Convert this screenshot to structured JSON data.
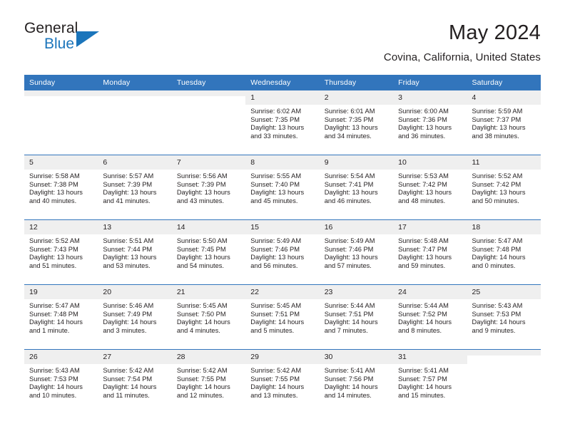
{
  "logo": {
    "word_one": "General",
    "word_two": "Blue",
    "triangle_color": "#1b75bb",
    "text_color": "#231f20"
  },
  "header": {
    "title": "May 2024",
    "subtitle": "Covina, California, United States"
  },
  "colors": {
    "header_blue": "#3275bc",
    "daynum_band": "#efefef",
    "text": "#231f20"
  },
  "calendar": {
    "weekday_headers": [
      "Sunday",
      "Monday",
      "Tuesday",
      "Wednesday",
      "Thursday",
      "Friday",
      "Saturday"
    ],
    "weeks": [
      [
        {
          "day": "",
          "sunrise": "",
          "sunset": "",
          "daylight": "",
          "empty": true
        },
        {
          "day": "",
          "sunrise": "",
          "sunset": "",
          "daylight": "",
          "empty": true
        },
        {
          "day": "",
          "sunrise": "",
          "sunset": "",
          "daylight": "",
          "empty": true
        },
        {
          "day": "1",
          "sunrise": "Sunrise: 6:02 AM",
          "sunset": "Sunset: 7:35 PM",
          "daylight": "Daylight: 13 hours and 33 minutes.",
          "empty": false
        },
        {
          "day": "2",
          "sunrise": "Sunrise: 6:01 AM",
          "sunset": "Sunset: 7:35 PM",
          "daylight": "Daylight: 13 hours and 34 minutes.",
          "empty": false
        },
        {
          "day": "3",
          "sunrise": "Sunrise: 6:00 AM",
          "sunset": "Sunset: 7:36 PM",
          "daylight": "Daylight: 13 hours and 36 minutes.",
          "empty": false
        },
        {
          "day": "4",
          "sunrise": "Sunrise: 5:59 AM",
          "sunset": "Sunset: 7:37 PM",
          "daylight": "Daylight: 13 hours and 38 minutes.",
          "empty": false
        }
      ],
      [
        {
          "day": "5",
          "sunrise": "Sunrise: 5:58 AM",
          "sunset": "Sunset: 7:38 PM",
          "daylight": "Daylight: 13 hours and 40 minutes.",
          "empty": false
        },
        {
          "day": "6",
          "sunrise": "Sunrise: 5:57 AM",
          "sunset": "Sunset: 7:39 PM",
          "daylight": "Daylight: 13 hours and 41 minutes.",
          "empty": false
        },
        {
          "day": "7",
          "sunrise": "Sunrise: 5:56 AM",
          "sunset": "Sunset: 7:39 PM",
          "daylight": "Daylight: 13 hours and 43 minutes.",
          "empty": false
        },
        {
          "day": "8",
          "sunrise": "Sunrise: 5:55 AM",
          "sunset": "Sunset: 7:40 PM",
          "daylight": "Daylight: 13 hours and 45 minutes.",
          "empty": false
        },
        {
          "day": "9",
          "sunrise": "Sunrise: 5:54 AM",
          "sunset": "Sunset: 7:41 PM",
          "daylight": "Daylight: 13 hours and 46 minutes.",
          "empty": false
        },
        {
          "day": "10",
          "sunrise": "Sunrise: 5:53 AM",
          "sunset": "Sunset: 7:42 PM",
          "daylight": "Daylight: 13 hours and 48 minutes.",
          "empty": false
        },
        {
          "day": "11",
          "sunrise": "Sunrise: 5:52 AM",
          "sunset": "Sunset: 7:42 PM",
          "daylight": "Daylight: 13 hours and 50 minutes.",
          "empty": false
        }
      ],
      [
        {
          "day": "12",
          "sunrise": "Sunrise: 5:52 AM",
          "sunset": "Sunset: 7:43 PM",
          "daylight": "Daylight: 13 hours and 51 minutes.",
          "empty": false
        },
        {
          "day": "13",
          "sunrise": "Sunrise: 5:51 AM",
          "sunset": "Sunset: 7:44 PM",
          "daylight": "Daylight: 13 hours and 53 minutes.",
          "empty": false
        },
        {
          "day": "14",
          "sunrise": "Sunrise: 5:50 AM",
          "sunset": "Sunset: 7:45 PM",
          "daylight": "Daylight: 13 hours and 54 minutes.",
          "empty": false
        },
        {
          "day": "15",
          "sunrise": "Sunrise: 5:49 AM",
          "sunset": "Sunset: 7:46 PM",
          "daylight": "Daylight: 13 hours and 56 minutes.",
          "empty": false
        },
        {
          "day": "16",
          "sunrise": "Sunrise: 5:49 AM",
          "sunset": "Sunset: 7:46 PM",
          "daylight": "Daylight: 13 hours and 57 minutes.",
          "empty": false
        },
        {
          "day": "17",
          "sunrise": "Sunrise: 5:48 AM",
          "sunset": "Sunset: 7:47 PM",
          "daylight": "Daylight: 13 hours and 59 minutes.",
          "empty": false
        },
        {
          "day": "18",
          "sunrise": "Sunrise: 5:47 AM",
          "sunset": "Sunset: 7:48 PM",
          "daylight": "Daylight: 14 hours and 0 minutes.",
          "empty": false
        }
      ],
      [
        {
          "day": "19",
          "sunrise": "Sunrise: 5:47 AM",
          "sunset": "Sunset: 7:48 PM",
          "daylight": "Daylight: 14 hours and 1 minute.",
          "empty": false
        },
        {
          "day": "20",
          "sunrise": "Sunrise: 5:46 AM",
          "sunset": "Sunset: 7:49 PM",
          "daylight": "Daylight: 14 hours and 3 minutes.",
          "empty": false
        },
        {
          "day": "21",
          "sunrise": "Sunrise: 5:45 AM",
          "sunset": "Sunset: 7:50 PM",
          "daylight": "Daylight: 14 hours and 4 minutes.",
          "empty": false
        },
        {
          "day": "22",
          "sunrise": "Sunrise: 5:45 AM",
          "sunset": "Sunset: 7:51 PM",
          "daylight": "Daylight: 14 hours and 5 minutes.",
          "empty": false
        },
        {
          "day": "23",
          "sunrise": "Sunrise: 5:44 AM",
          "sunset": "Sunset: 7:51 PM",
          "daylight": "Daylight: 14 hours and 7 minutes.",
          "empty": false
        },
        {
          "day": "24",
          "sunrise": "Sunrise: 5:44 AM",
          "sunset": "Sunset: 7:52 PM",
          "daylight": "Daylight: 14 hours and 8 minutes.",
          "empty": false
        },
        {
          "day": "25",
          "sunrise": "Sunrise: 5:43 AM",
          "sunset": "Sunset: 7:53 PM",
          "daylight": "Daylight: 14 hours and 9 minutes.",
          "empty": false
        }
      ],
      [
        {
          "day": "26",
          "sunrise": "Sunrise: 5:43 AM",
          "sunset": "Sunset: 7:53 PM",
          "daylight": "Daylight: 14 hours and 10 minutes.",
          "empty": false
        },
        {
          "day": "27",
          "sunrise": "Sunrise: 5:42 AM",
          "sunset": "Sunset: 7:54 PM",
          "daylight": "Daylight: 14 hours and 11 minutes.",
          "empty": false
        },
        {
          "day": "28",
          "sunrise": "Sunrise: 5:42 AM",
          "sunset": "Sunset: 7:55 PM",
          "daylight": "Daylight: 14 hours and 12 minutes.",
          "empty": false
        },
        {
          "day": "29",
          "sunrise": "Sunrise: 5:42 AM",
          "sunset": "Sunset: 7:55 PM",
          "daylight": "Daylight: 14 hours and 13 minutes.",
          "empty": false
        },
        {
          "day": "30",
          "sunrise": "Sunrise: 5:41 AM",
          "sunset": "Sunset: 7:56 PM",
          "daylight": "Daylight: 14 hours and 14 minutes.",
          "empty": false
        },
        {
          "day": "31",
          "sunrise": "Sunrise: 5:41 AM",
          "sunset": "Sunset: 7:57 PM",
          "daylight": "Daylight: 14 hours and 15 minutes.",
          "empty": false
        },
        {
          "day": "",
          "sunrise": "",
          "sunset": "",
          "daylight": "",
          "empty": true
        }
      ]
    ]
  }
}
